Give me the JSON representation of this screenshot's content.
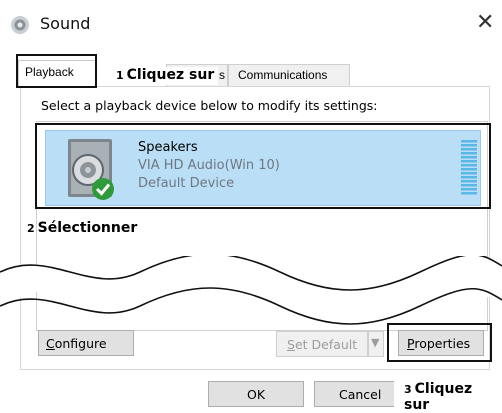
{
  "window": {
    "title": "Sound",
    "close_glyph": "✕"
  },
  "tabs": [
    {
      "label": "Playback",
      "selected": true
    },
    {
      "label": "s",
      "selected": false
    },
    {
      "label": "Communications",
      "selected": false
    }
  ],
  "panel": {
    "instruction": "Select a playback device below to modify its settings:"
  },
  "device": {
    "name": "Speakers",
    "driver": "VIA HD Audio(Win 10)",
    "status": "Default Device",
    "icon": "speaker-icon",
    "badge_icon": "check-icon"
  },
  "buttons": {
    "configure": {
      "first": "C",
      "rest": "onfigure"
    },
    "set_default": {
      "first": "S",
      "rest": "et Default",
      "enabled": false
    },
    "dropdown": "▼",
    "properties": {
      "first": "P",
      "rest": "roperties"
    },
    "ok": "OK",
    "cancel": "Cancel"
  },
  "callouts": {
    "c1": {
      "num": "1",
      "text": "Cliquez sur"
    },
    "c2": {
      "num": "2",
      "text": "Sélectionner"
    },
    "c3": {
      "num": "3",
      "text": "Cliquez sur"
    }
  },
  "colors": {
    "selection": "#b9def6",
    "muted_text": "#6f7780",
    "check_green": "#2e9b3a"
  }
}
